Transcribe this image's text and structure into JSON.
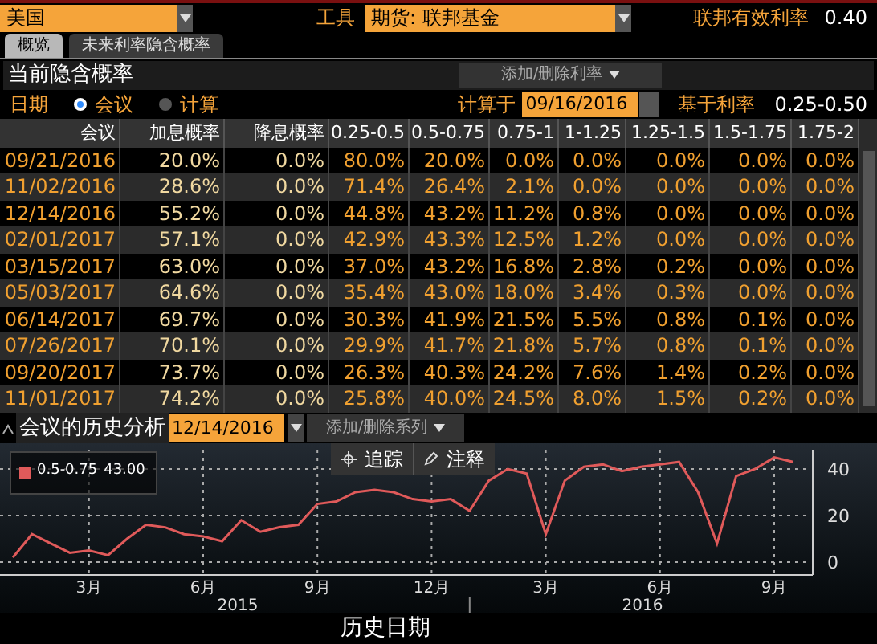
{
  "top_bar": {
    "country": "美国",
    "instrument_label": "工具",
    "instrument": "期货: 联邦基金",
    "rate_label": "联邦有效利率",
    "rate_value": "0.40"
  },
  "tabs": [
    {
      "label": "概览",
      "selected": true
    },
    {
      "label": "未来利率隐含概率",
      "selected": false
    }
  ],
  "section": {
    "title": "当前隐含概率",
    "add_remove_button": "添加/删除利率"
  },
  "options": {
    "date_label": "日期",
    "radios": [
      {
        "label": "会议",
        "selected": true
      },
      {
        "label": "计算",
        "selected": false
      }
    ],
    "calc_label": "计算于",
    "calc_date": "09/16/2016",
    "base_label": "基于利率",
    "base_value": "0.25-0.50"
  },
  "table": {
    "columns": [
      "会议",
      "加息概率",
      "降息概率",
      "0.25-0.5",
      "0.5-0.75",
      "0.75-1",
      "1-1.25",
      "1.25-1.5",
      "1.5-1.75",
      "1.75-2"
    ],
    "rows": [
      [
        "09/21/2016",
        "20.0%",
        "0.0%",
        "80.0%",
        "20.0%",
        "0.0%",
        "0.0%",
        "0.0%",
        "0.0%",
        "0.0%"
      ],
      [
        "11/02/2016",
        "28.6%",
        "0.0%",
        "71.4%",
        "26.4%",
        "2.1%",
        "0.0%",
        "0.0%",
        "0.0%",
        "0.0%"
      ],
      [
        "12/14/2016",
        "55.2%",
        "0.0%",
        "44.8%",
        "43.2%",
        "11.2%",
        "0.8%",
        "0.0%",
        "0.0%",
        "0.0%"
      ],
      [
        "02/01/2017",
        "57.1%",
        "0.0%",
        "42.9%",
        "43.3%",
        "12.5%",
        "1.2%",
        "0.0%",
        "0.0%",
        "0.0%"
      ],
      [
        "03/15/2017",
        "63.0%",
        "0.0%",
        "37.0%",
        "43.2%",
        "16.8%",
        "2.8%",
        "0.2%",
        "0.0%",
        "0.0%"
      ],
      [
        "05/03/2017",
        "64.6%",
        "0.0%",
        "35.4%",
        "43.0%",
        "18.0%",
        "3.4%",
        "0.3%",
        "0.0%",
        "0.0%"
      ],
      [
        "06/14/2017",
        "69.7%",
        "0.0%",
        "30.3%",
        "41.9%",
        "21.5%",
        "5.5%",
        "0.8%",
        "0.1%",
        "0.0%"
      ],
      [
        "07/26/2017",
        "70.1%",
        "0.0%",
        "29.9%",
        "41.7%",
        "21.8%",
        "5.7%",
        "0.8%",
        "0.1%",
        "0.0%"
      ],
      [
        "09/20/2017",
        "73.7%",
        "0.0%",
        "26.3%",
        "40.3%",
        "24.2%",
        "7.6%",
        "1.4%",
        "0.2%",
        "0.0%"
      ],
      [
        "11/01/2017",
        "74.2%",
        "0.0%",
        "25.8%",
        "40.0%",
        "24.5%",
        "8.0%",
        "1.5%",
        "0.2%",
        "0.0%"
      ]
    ]
  },
  "history": {
    "title": "会议的历史分析",
    "date": "12/14/2016",
    "add_remove_button": "添加/删除系列",
    "track_button": "追踪",
    "annotate_button": "注释",
    "legend_value": "43.00",
    "year_labels": [
      "2015",
      "2016"
    ],
    "chart_data": {
      "type": "line",
      "xlabel": "历史日期",
      "categories": [
        null,
        null,
        null,
        null,
        "3月",
        null,
        null,
        null,
        null,
        null,
        "6月",
        null,
        null,
        null,
        null,
        null,
        "9月",
        null,
        null,
        null,
        null,
        null,
        "12月",
        null,
        null,
        null,
        null,
        null,
        "3月",
        null,
        null,
        null,
        null,
        null,
        "6月",
        null,
        null,
        null,
        null,
        null,
        "9月",
        null
      ],
      "series": [
        {
          "name": "0.5-0.75",
          "color": "#e05a5a",
          "values": [
            2,
            12,
            8,
            4,
            5,
            3,
            10,
            16,
            15,
            12,
            11,
            9,
            18,
            13,
            15,
            16,
            25,
            26,
            30,
            31,
            30,
            27,
            26,
            27,
            22,
            35,
            40,
            38,
            12,
            35,
            41,
            42,
            39,
            41,
            42,
            43,
            30,
            8,
            37,
            40,
            45,
            43
          ]
        }
      ],
      "ylim": [
        0,
        50
      ],
      "grid": true,
      "yticks": [
        0,
        20,
        40
      ]
    }
  }
}
